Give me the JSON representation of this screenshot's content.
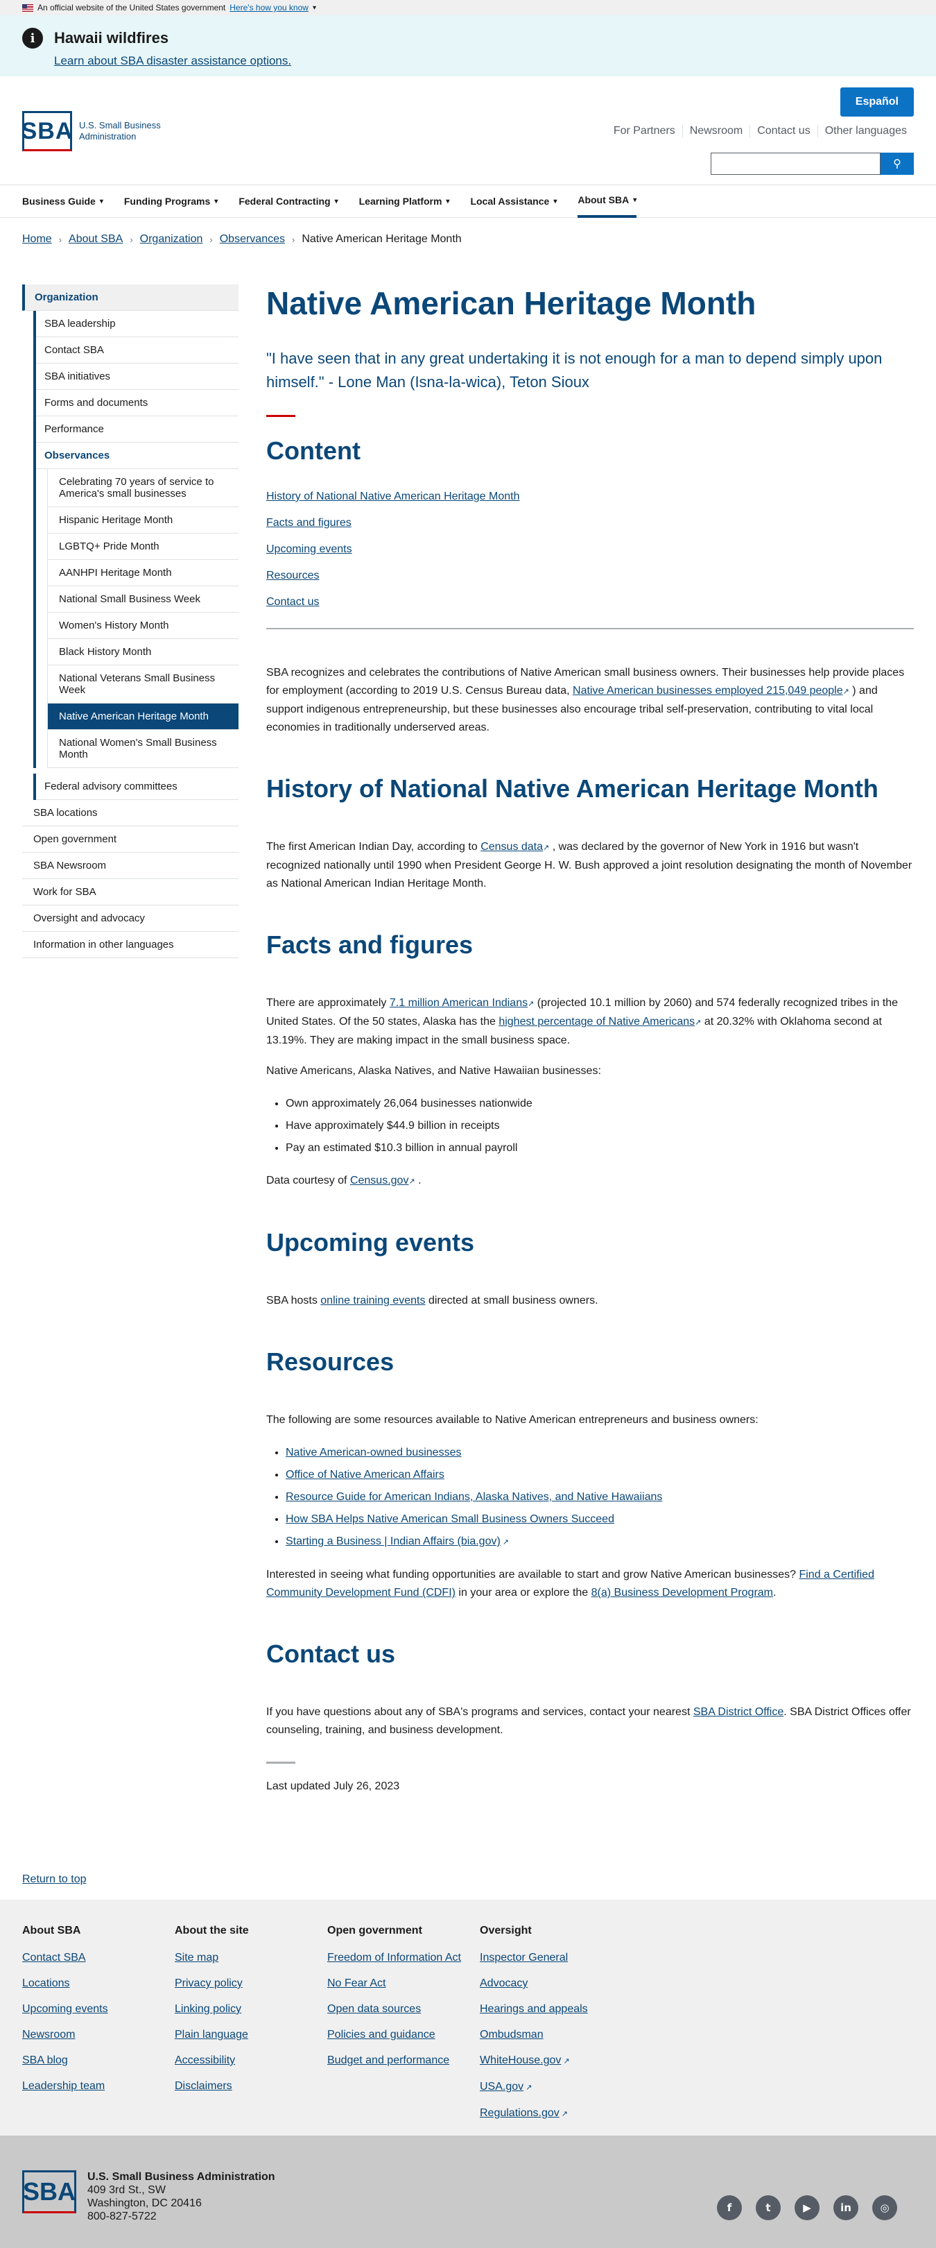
{
  "gov_banner": {
    "text": "An official website of the United States government",
    "link": "Here's how you know"
  },
  "alert": {
    "title": "Hawaii wildfires",
    "link": "Learn about SBA disaster assistance options."
  },
  "header": {
    "logo_text": "U.S. Small Business Administration",
    "logo_mark": "SBA",
    "espanol": "Español",
    "secondary_links": [
      "For Partners",
      "Newsroom",
      "Contact us",
      "Other languages"
    ],
    "search_placeholder": ""
  },
  "nav": [
    "Business Guide",
    "Funding Programs",
    "Federal Contracting",
    "Learning Platform",
    "Local Assistance",
    "About SBA"
  ],
  "breadcrumbs": [
    "Home",
    "About SBA",
    "Organization",
    "Observances",
    "Native American Heritage Month"
  ],
  "sidebar": {
    "heading": "Organization",
    "items": [
      "SBA leadership",
      "Contact SBA",
      "SBA initiatives",
      "Forms and documents",
      "Performance",
      "Observances"
    ],
    "observances": [
      "Celebrating 70 years of service to America's small businesses",
      "Hispanic Heritage Month",
      "LGBTQ+ Pride Month",
      "AANHPI Heritage Month",
      "National Small Business Week",
      "Women's History Month",
      "Black History Month",
      "National Veterans Small Business Week",
      "Native American Heritage Month",
      "National Women's Small Business Month"
    ],
    "federal": "Federal advisory committees",
    "top_items": [
      "SBA locations",
      "Open government",
      "SBA Newsroom",
      "Work for SBA",
      "Oversight and advocacy",
      "Information in other languages"
    ]
  },
  "main": {
    "title": "Native American Heritage Month",
    "quote": "\"I have seen that in any great undertaking it is not enough for a man to depend simply upon himself.\" - Lone Man (Isna-la-wica), Teton Sioux",
    "content_heading": "Content",
    "toc": [
      "History of National Native American Heritage Month",
      "Facts and figures",
      "Upcoming events",
      "Resources",
      "Contact us"
    ],
    "intro_1": "SBA recognizes and celebrates the contributions of Native American small business owners. Their businesses help provide places for employment (according to 2019 U.S. Census Bureau data,",
    "intro_link": "Native American businesses employed 215,049 people",
    "intro_2": ") and support indigenous entrepreneurship, but these businesses also encourage tribal self-preservation, contributing to vital local economies in traditionally underserved areas.",
    "history_heading": "History of National Native American Heritage Month",
    "history_1": "The first American Indian Day, according to",
    "history_link": "Census data",
    "history_2": ", was declared by the governor of New York in 1916 but wasn't recognized nationally until 1990 when President George H. W. Bush approved a joint resolution designating the month of November as National American Indian Heritage Month.",
    "facts_heading": "Facts and figures",
    "facts_1": "There are approximately",
    "facts_link1": "7.1 million American Indians",
    "facts_2": "(projected 10.1 million by 2060) and 574 federally recognized tribes in the United States. Of the 50 states, Alaska has the",
    "facts_link2": "highest percentage of Native Americans",
    "facts_3": "at 20.32% with Oklahoma second at 13.19%. They are making impact in the small business space.",
    "facts_list_intro": "Native Americans, Alaska Natives, and Native Hawaiian businesses:",
    "facts_list": [
      "Own approximately 26,064 businesses nationwide",
      "Have approximately $44.9 billion in receipts",
      "Pay an estimated $10.3 billion in annual payroll"
    ],
    "courtesy_1": "Data courtesy of",
    "courtesy_link": "Census.gov",
    "courtesy_2": ".",
    "events_heading": "Upcoming events",
    "events_1": "SBA hosts",
    "events_link": "online training events",
    "events_2": "directed at small business owners.",
    "resources_heading": "Resources",
    "resources_intro": "The following are some resources available to Native American entrepreneurs and business owners:",
    "resources_list": [
      "Native American-owned businesses",
      "Office of Native American Affairs",
      "Resource Guide for American Indians, Alaska Natives, and Native Hawaiians",
      "How SBA Helps Native American Small Business Owners Succeed",
      "Starting a Business | Indian Affairs (bia.gov)"
    ],
    "funding_1": "Interested in seeing what funding opportunities are available to start and grow Native American businesses?",
    "funding_link1": "Find a Certified Community Development Fund (CDFI)",
    "funding_2": "in your area or explore the",
    "funding_link2": "8(a) Business Development Program",
    "funding_3": ".",
    "contact_heading": "Contact us",
    "contact_1": "If you have questions about any of SBA's programs and services, contact your nearest",
    "contact_link": "SBA District Office",
    "contact_2": ". SBA District Offices offer counseling, training, and business development.",
    "updated": "Last updated July 26, 2023"
  },
  "return_top": "Return to top",
  "footer": {
    "columns": [
      {
        "title": "About SBA",
        "links": [
          "Contact SBA",
          "Locations",
          "Upcoming events",
          "Newsroom",
          "SBA blog",
          "Leadership team"
        ]
      },
      {
        "title": "About the site",
        "links": [
          "Site map",
          "Privacy policy",
          "Linking policy",
          "Plain language",
          "Accessibility",
          "Disclaimers"
        ]
      },
      {
        "title": "Open government",
        "links": [
          "Freedom of Information Act",
          "No Fear Act",
          "Open data sources",
          "Policies and guidance",
          "Budget and performance"
        ]
      },
      {
        "title": "Oversight",
        "links": [
          "Inspector General",
          "Advocacy",
          "Hearings and appeals",
          "Ombudsman",
          "WhiteHouse.gov",
          "USA.gov",
          "Regulations.gov"
        ]
      }
    ],
    "org": "U.S. Small Business Administration",
    "address1": "409 3rd St., SW",
    "address2": "Washington, DC 20416",
    "phone": "800-827-5722",
    "social": [
      "facebook-icon",
      "twitter-icon",
      "youtube-icon",
      "linkedin-icon",
      "instagram-icon"
    ]
  }
}
